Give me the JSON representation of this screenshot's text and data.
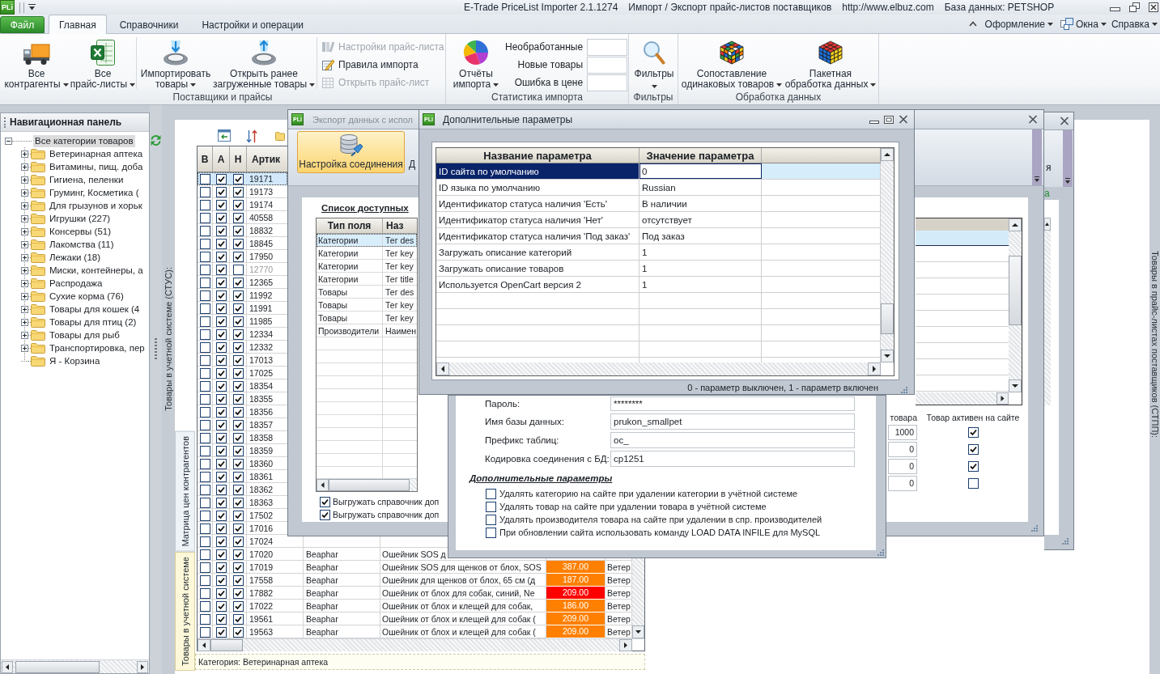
{
  "title_bar": {
    "logo": "PLi",
    "title_parts": [
      "E-Trade PriceList Importer 2.1.1274",
      "Импорт / Экспорт прайс-листов поставщиков",
      "http://www.elbuz.com",
      "База данных: PETSHOP"
    ]
  },
  "ribbon_tabs": [
    {
      "label": "Файл",
      "kind": "file",
      "selected": false
    },
    {
      "label": "Главная",
      "kind": "tab",
      "selected": true
    },
    {
      "label": "Справочники",
      "kind": "tab",
      "selected": false
    },
    {
      "label": "Настройки и операции",
      "kind": "tab",
      "selected": false
    }
  ],
  "ribbon_menus": [
    {
      "label": "Оформление",
      "kind": "menu"
    },
    {
      "label": "Окна",
      "kind": "windows"
    },
    {
      "label": "Справка",
      "kind": "menu"
    }
  ],
  "ribbon_groups": [
    {
      "label": "Поставщики и прайсы",
      "large_buttons": [
        {
          "lines": [
            "Все",
            "контрагенты"
          ],
          "dropdown": true
        },
        {
          "lines": [
            "Все",
            "прайс-листы"
          ],
          "dropdown": true
        },
        {
          "lines": [
            "Импортировать",
            "товары"
          ],
          "dropdown": true
        },
        {
          "lines": [
            "Открыть ранее",
            "загруженные товары"
          ],
          "dropdown": true
        }
      ],
      "small_buttons": [
        {
          "label": "Настройки прайс-листа",
          "disabled": true
        },
        {
          "label": "Правила импорта",
          "disabled": false
        },
        {
          "label": "Открыть прайс-лист",
          "disabled": true
        }
      ]
    },
    {
      "label": "Статистика импорта",
      "large_buttons": [
        {
          "lines": [
            "Отчёты",
            "импорта"
          ],
          "dropdown": true
        }
      ],
      "counters": [
        {
          "label": "Необработанные"
        },
        {
          "label": "Новые товары"
        },
        {
          "label": "Ошибка в цене"
        }
      ]
    },
    {
      "label": "Фильтры",
      "large_buttons": [
        {
          "lines": [
            "Фильтры"
          ],
          "dropdown": true
        }
      ]
    },
    {
      "label": "Обработка данных",
      "large_buttons": [
        {
          "lines": [
            "Сопоставление",
            "одинаковых товаров"
          ],
          "dropdown": true
        },
        {
          "lines": [
            "Пакетная",
            "обработка данных"
          ],
          "dropdown": true
        }
      ]
    }
  ],
  "navigation_panel": {
    "title": "Навигационная панель",
    "tree": [
      {
        "label": "Все категории товаров",
        "kind": "branch",
        "expanded": true,
        "selected": true,
        "children": [
          {
            "label": "Ветеринарная аптека",
            "kind": "branch",
            "expanded": false,
            "selected": false
          },
          {
            "label": "Витамины, пищ. доба",
            "kind": "branch",
            "expanded": false,
            "selected": false
          },
          {
            "label": "Гигиена, пеленки",
            "kind": "branch",
            "expanded": false,
            "selected": false
          },
          {
            "label": "Груминг, Косметика (",
            "kind": "branch",
            "expanded": false,
            "selected": false
          },
          {
            "label": "Для грызунов и хорьк",
            "kind": "branch",
            "expanded": false,
            "selected": false
          },
          {
            "label": "Игрушки (227)",
            "kind": "branch",
            "expanded": false,
            "selected": false
          },
          {
            "label": "Консервы (51)",
            "kind": "branch",
            "expanded": false,
            "selected": false
          },
          {
            "label": "Лакомства (11)",
            "kind": "branch",
            "expanded": false,
            "selected": false
          },
          {
            "label": "Лежаки (18)",
            "kind": "branch",
            "expanded": false,
            "selected": false
          },
          {
            "label": "Миски, контейнеры, а",
            "kind": "branch",
            "expanded": false,
            "selected": false
          },
          {
            "label": "Распродажа",
            "kind": "branch",
            "expanded": false,
            "selected": false
          },
          {
            "label": "Сухие корма (76)",
            "kind": "branch",
            "expanded": false,
            "selected": false
          },
          {
            "label": "Товары для кошек (4",
            "kind": "branch",
            "expanded": false,
            "selected": false
          },
          {
            "label": "Товары для птиц (2)",
            "kind": "branch",
            "expanded": false,
            "selected": false
          },
          {
            "label": "Товары для рыб",
            "kind": "branch",
            "expanded": false,
            "selected": false
          },
          {
            "label": "Транспортировка, пер",
            "kind": "branch",
            "expanded": false,
            "selected": false
          },
          {
            "label": "Я - Корзина",
            "kind": "leaf",
            "expanded": false,
            "selected": false
          }
        ]
      }
    ]
  },
  "document": {
    "side_label": "Товары в учетной системе (СТУС):",
    "right_label": "Товары в прайс-листах поставщиков (СТПП):",
    "vertical_tabs": [
      {
        "label": "Матрица цен контрагентов",
        "selected": false
      },
      {
        "label": "Товары в учетной системе",
        "selected": true
      }
    ],
    "products": {
      "columns": [
        "В",
        "А",
        "Н",
        "Артик"
      ],
      "rows": [
        {
          "article": "19171",
          "v": false,
          "a": true,
          "n": true,
          "selected": true,
          "dimmed": false
        },
        {
          "article": "19173",
          "v": false,
          "a": true,
          "n": true,
          "selected": false,
          "dimmed": false
        },
        {
          "article": "19174",
          "v": false,
          "a": true,
          "n": true,
          "selected": false,
          "dimmed": false
        },
        {
          "article": "40558",
          "v": false,
          "a": true,
          "n": true,
          "selected": false,
          "dimmed": false
        },
        {
          "article": "18832",
          "v": false,
          "a": true,
          "n": true,
          "selected": false,
          "dimmed": false
        },
        {
          "article": "18845",
          "v": false,
          "a": true,
          "n": true,
          "selected": false,
          "dimmed": false
        },
        {
          "article": "17950",
          "v": false,
          "a": true,
          "n": true,
          "selected": false,
          "dimmed": false
        },
        {
          "article": "12770",
          "v": false,
          "a": true,
          "n": false,
          "selected": false,
          "dimmed": true
        },
        {
          "article": "12365",
          "v": false,
          "a": true,
          "n": true,
          "selected": false,
          "dimmed": false
        },
        {
          "article": "11992",
          "v": false,
          "a": true,
          "n": true,
          "selected": false,
          "dimmed": false
        },
        {
          "article": "11991",
          "v": false,
          "a": true,
          "n": true,
          "selected": false,
          "dimmed": false
        },
        {
          "article": "11985",
          "v": false,
          "a": true,
          "n": true,
          "selected": false,
          "dimmed": false
        },
        {
          "article": "12334",
          "v": false,
          "a": true,
          "n": true,
          "selected": false,
          "dimmed": false
        },
        {
          "article": "12332",
          "v": false,
          "a": true,
          "n": true,
          "selected": false,
          "dimmed": false
        },
        {
          "article": "17013",
          "v": false,
          "a": true,
          "n": true,
          "selected": false,
          "dimmed": false
        },
        {
          "article": "17025",
          "v": false,
          "a": true,
          "n": true,
          "selected": false,
          "dimmed": false
        },
        {
          "article": "18354",
          "v": false,
          "a": true,
          "n": true,
          "selected": false,
          "dimmed": false
        },
        {
          "article": "18355",
          "v": false,
          "a": true,
          "n": true,
          "selected": false,
          "dimmed": false
        },
        {
          "article": "18356",
          "v": false,
          "a": true,
          "n": true,
          "selected": false,
          "dimmed": false
        },
        {
          "article": "18357",
          "v": false,
          "a": true,
          "n": true,
          "selected": false,
          "dimmed": false
        },
        {
          "article": "18358",
          "v": false,
          "a": true,
          "n": true,
          "selected": false,
          "dimmed": false
        },
        {
          "article": "18359",
          "v": false,
          "a": true,
          "n": true,
          "selected": false,
          "dimmed": false
        },
        {
          "article": "18360",
          "v": false,
          "a": true,
          "n": true,
          "selected": false,
          "dimmed": false
        },
        {
          "article": "18361",
          "v": false,
          "a": true,
          "n": true,
          "selected": false,
          "dimmed": false
        },
        {
          "article": "18362",
          "v": false,
          "a": true,
          "n": true,
          "selected": false,
          "dimmed": false
        },
        {
          "article": "18363",
          "v": false,
          "a": true,
          "n": true,
          "selected": false,
          "dimmed": false
        },
        {
          "article": "17502",
          "v": false,
          "a": true,
          "n": true,
          "selected": false,
          "dimmed": false
        },
        {
          "article": "17016",
          "v": false,
          "a": true,
          "n": true,
          "selected": false,
          "dimmed": false
        },
        {
          "article": "17024",
          "v": false,
          "a": true,
          "n": true,
          "selected": false,
          "dimmed": false
        },
        {
          "article": "17020",
          "v": false,
          "a": true,
          "n": true,
          "selected": false,
          "dimmed": false,
          "brand": "Beaphar",
          "name": "Ошейник SOS д"
        },
        {
          "article": "17019",
          "v": false,
          "a": true,
          "n": true,
          "selected": false,
          "dimmed": false,
          "brand": "Beaphar",
          "name": "Ошейник SOS для щенков от блох, SOS",
          "price": {
            "text": "387.00",
            "color": "#ff8000"
          },
          "category": "Ветер"
        },
        {
          "article": "17558",
          "v": false,
          "a": true,
          "n": true,
          "selected": false,
          "dimmed": false,
          "brand": "Beaphar",
          "name": "Ошейник для щенков от блох, 65 см (д",
          "price": {
            "text": "187.00",
            "color": "#ff8000"
          },
          "category": "Ветер"
        },
        {
          "article": "17882",
          "v": false,
          "a": true,
          "n": true,
          "selected": false,
          "dimmed": false,
          "brand": "Beaphar",
          "name": "Ошейник от блох для собак, синий, Ne",
          "price": {
            "text": "209.00",
            "color": "#ff0000"
          },
          "category": "Ветер"
        },
        {
          "article": "17022",
          "v": false,
          "a": true,
          "n": true,
          "selected": false,
          "dimmed": false,
          "brand": "Beaphar",
          "name": "Ошейник от блох и клещей для собак,",
          "price": {
            "text": "186.00",
            "color": "#ff8000"
          },
          "category": "Ветер"
        },
        {
          "article": "19561",
          "v": false,
          "a": true,
          "n": true,
          "selected": false,
          "dimmed": false,
          "brand": "Beaphar",
          "name": "Ошейник от блох и клещей для собак (",
          "price": {
            "text": "209.00",
            "color": "#ff8000"
          },
          "category": "Ветер"
        },
        {
          "article": "19563",
          "v": false,
          "a": true,
          "n": true,
          "selected": false,
          "dimmed": false,
          "brand": "Beaphar",
          "name": "Ошейник от блох и клещей для собак (",
          "price": {
            "text": "209.00",
            "color": "#ff8000"
          },
          "category": "Ветер"
        }
      ]
    },
    "status_bar": "Категория: Ветеринарная аптека"
  },
  "background_window": {
    "toolbar_fragment": "я",
    "link_fragment": "а"
  },
  "export_window": {
    "logo": "PLi",
    "title": "Экспорт данных с испол",
    "toolbar": [
      {
        "label": "Настройка соединения",
        "selected": true
      },
      {
        "label": "Д",
        "selected": false
      }
    ],
    "fields_heading": "Список доступных",
    "fields_table": {
      "columns": [
        "Тип поля",
        "Наз"
      ],
      "rows": [
        {
          "type": "Категории",
          "field": "Тег des",
          "selected": true
        },
        {
          "type": "Категории",
          "field": "Тег key",
          "selected": false
        },
        {
          "type": "Категории",
          "field": "Тег key",
          "selected": false
        },
        {
          "type": "Категории",
          "field": "Тег title",
          "selected": false
        },
        {
          "type": "Товары",
          "field": "Тег des",
          "selected": false
        },
        {
          "type": "Товары",
          "field": "Тег key",
          "selected": false
        },
        {
          "type": "Товары",
          "field": "Тег key",
          "selected": false
        },
        {
          "type": "Производители",
          "field": "Наимен",
          "selected": false
        }
      ]
    },
    "export_options": [
      {
        "label": "Выгружать справочник доп",
        "checked": true
      },
      {
        "label": "Выгружать справочник доп",
        "checked": true
      }
    ],
    "stock_table": {
      "columns": [
        "товара",
        "Товар активен на сайте"
      ],
      "rows": [
        {
          "quantity": "1000",
          "active": true
        },
        {
          "quantity": "0",
          "active": true
        },
        {
          "quantity": "0",
          "active": true
        },
        {
          "quantity": "0",
          "active": false
        }
      ]
    }
  },
  "connection_window": {
    "fields": [
      {
        "label": "Пароль:",
        "value": "********"
      },
      {
        "label": "Имя базы данных:",
        "value": "prukon_smallpet"
      },
      {
        "label": "Префикс таблиц:",
        "value": "oc_"
      },
      {
        "label": "Кодировка соединения с БД:",
        "value": "cp1251"
      }
    ],
    "extra_heading": "Дополнительные параметры",
    "extra_options": [
      {
        "label": "Удалять категорию на сайте при удалении категории в учётной системе",
        "checked": false
      },
      {
        "label": "Удалять товар на сайте при удалении товара в учётной системе",
        "checked": false
      },
      {
        "label": "Удалять производителя товара на сайте при удалении в спр. производителей",
        "checked": false
      },
      {
        "label": "При обновлении сайта использовать команду LOAD DATA INFILE для MySQL",
        "checked": false
      }
    ]
  },
  "parameters_window": {
    "logo": "PLi",
    "title": "Дополнительные параметры",
    "columns": [
      "Название параметра",
      "Значение параметра"
    ],
    "rows": [
      {
        "name": "ID сайта по умолчанию",
        "value": "0",
        "selected": true
      },
      {
        "name": "ID языка по умолчанию",
        "value": "Russian",
        "selected": false
      },
      {
        "name": "Идентификатор статуса наличия 'Есть'",
        "value": "В наличии",
        "selected": false
      },
      {
        "name": "Идентификатор статуса наличия 'Нет'",
        "value": "отсутствует",
        "selected": false
      },
      {
        "name": "Идентификатор статуса наличия 'Под заказ'",
        "value": "Под заказ",
        "selected": false
      },
      {
        "name": "Загружать описание категорий",
        "value": "1",
        "selected": false
      },
      {
        "name": "Загружать описание товаров",
        "value": "1",
        "selected": false
      },
      {
        "name": "Используется OpenCart версия 2",
        "value": "1",
        "selected": false
      }
    ],
    "footer": "0 - параметр выключен, 1 - параметр включен"
  }
}
